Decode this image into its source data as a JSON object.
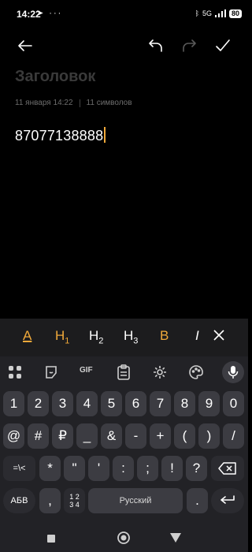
{
  "status_bar": {
    "time": "14:22",
    "signal_label": "5G",
    "battery": "80",
    "icons": [
      "telegram-icon",
      "more-icon",
      "bluetooth-icon",
      "signal-icon",
      "wifi-icon",
      "battery-icon"
    ]
  },
  "toolbar": {
    "icons": [
      "back-arrow-icon",
      "undo-icon",
      "redo-icon",
      "checkmark-icon"
    ]
  },
  "note": {
    "title_placeholder": "Заголовок",
    "date": "11 января 14:22",
    "char_count": "11 символов",
    "body": "87077138888"
  },
  "format_bar": {
    "text_style": "A",
    "h1": "H",
    "h1_sub": "1",
    "h2": "H",
    "h2_sub": "2",
    "h3": "H",
    "h3_sub": "3",
    "bold": "B",
    "italic": "I"
  },
  "keyboard": {
    "tool_row": {
      "gif": "GIF"
    },
    "row1": [
      "1",
      "2",
      "3",
      "4",
      "5",
      "6",
      "7",
      "8",
      "9",
      "0"
    ],
    "row2": [
      "@",
      "#",
      "₽",
      "_",
      "&",
      "-",
      "+",
      "(",
      ")",
      "/"
    ],
    "row3": [
      "=\\<",
      "*",
      "\"",
      "'",
      ":",
      ";",
      "!",
      "?"
    ],
    "row4": {
      "lang_key": "АБВ",
      "comma": ",",
      "numpad_top": "1 2",
      "numpad_bottom": "3 4",
      "space": "Русский",
      "period": "."
    }
  },
  "colors": {
    "accent": "#f0a93a",
    "background": "#000000",
    "keyboard_bg": "#222226",
    "key_bg": "#3c3c42"
  }
}
